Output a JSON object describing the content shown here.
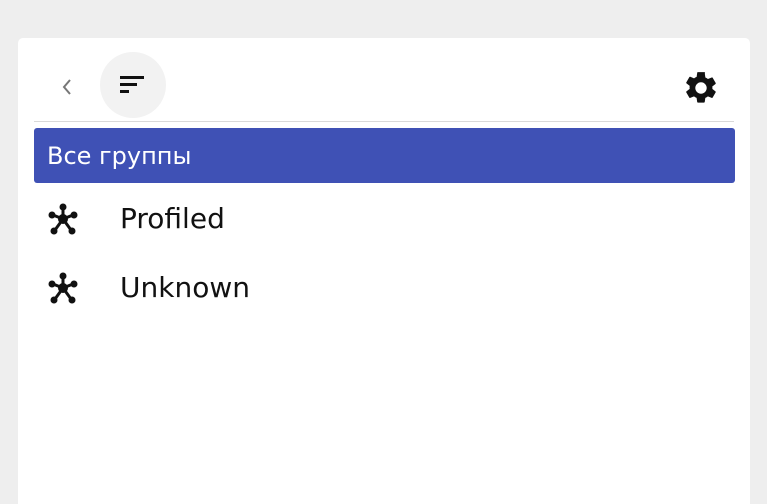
{
  "toolbar": {
    "back_icon": "chevron-left-icon",
    "filter_icon": "sort-filter-icon",
    "settings_icon": "gear-icon"
  },
  "groups": {
    "all_label": "Все группы",
    "items": [
      {
        "label": "Profiled",
        "icon": "network-group-icon"
      },
      {
        "label": "Unknown",
        "icon": "network-group-icon"
      }
    ]
  },
  "colors": {
    "accent": "#3f51b5",
    "background": "#eeeeee",
    "panel": "#ffffff"
  }
}
